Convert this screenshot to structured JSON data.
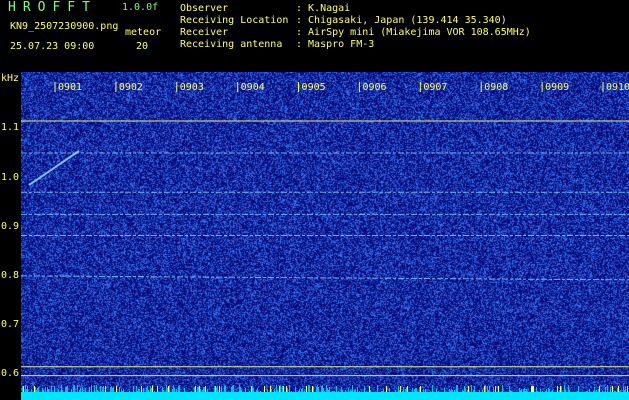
{
  "header": {
    "app_title": "HROFFT",
    "app_version": "1.0.0f",
    "file_name": "KN9_2507230900.png",
    "meteor_label": "meteor",
    "time_label": "25.07.23 09:00",
    "meteor_count": "20",
    "info": [
      {
        "label": "Observer",
        "value": ": K.Nagai"
      },
      {
        "label": "Receiving Location",
        "value": ": Chigasaki, Japan (139.414 35.340)"
      },
      {
        "label": "Receiver",
        "value": ": AirSpy mini (Miakejima VOR 108.65MHz)"
      },
      {
        "label": "Receiving antenna",
        "value": ": Maspro FM-3"
      }
    ]
  },
  "spectrogram": {
    "y_axis_label": "kHz",
    "y_ticks": [
      "1.1",
      "1.0",
      "0.9",
      "0.8",
      "0.7",
      "0.6"
    ],
    "y_tick_values": [
      1.1,
      1.0,
      0.9,
      0.8,
      0.7,
      0.6
    ],
    "y_range": [
      0.58,
      1.17
    ],
    "minute_labels": [
      "0901",
      "0902",
      "0903",
      "0904",
      "0905",
      "0906",
      "0907",
      "0908",
      "0909",
      "0910"
    ],
    "carrier_khz": [
      1.115,
      0.615,
      0.597
    ],
    "echo_lines_khz": [
      1.05,
      0.97,
      0.925,
      0.882,
      0.8
    ],
    "colors": {
      "background": "#080c7a",
      "noise": "#2a4fe0",
      "echo": "#8fd8ff",
      "carrier": "#e8e88a",
      "minute_marker": "#ffff66",
      "bottom_band": "#00e5ff"
    }
  }
}
